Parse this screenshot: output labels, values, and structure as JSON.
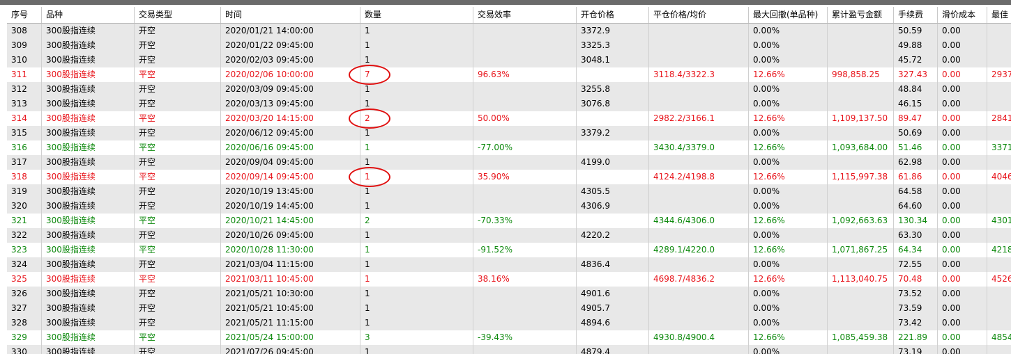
{
  "columns": [
    "序号",
    "品种",
    "交易类型",
    "时间",
    "数量",
    "交易效率",
    "开仓价格",
    "平仓价格/均价",
    "最大回撤(单品种)",
    "累计盈亏金额",
    "手续费",
    "滑价成本",
    "最佳"
  ],
  "rows": [
    {
      "id": "308",
      "product": "300股指连续",
      "type": "开空",
      "time": "2020/01/21 14:00:00",
      "qty": "1",
      "eff": "",
      "open": "3372.9",
      "close": "",
      "dd": "0.00%",
      "pnl": "",
      "fee": "50.59",
      "slip": "0.00",
      "best": "",
      "color": "black",
      "kind": "open"
    },
    {
      "id": "309",
      "product": "300股指连续",
      "type": "开空",
      "time": "2020/01/22 09:45:00",
      "qty": "1",
      "eff": "",
      "open": "3325.3",
      "close": "",
      "dd": "0.00%",
      "pnl": "",
      "fee": "49.88",
      "slip": "0.00",
      "best": "",
      "color": "black",
      "kind": "open"
    },
    {
      "id": "310",
      "product": "300股指连续",
      "type": "开空",
      "time": "2020/02/03 09:45:00",
      "qty": "1",
      "eff": "",
      "open": "3048.1",
      "close": "",
      "dd": "0.00%",
      "pnl": "",
      "fee": "45.72",
      "slip": "0.00",
      "best": "",
      "color": "black",
      "kind": "open"
    },
    {
      "id": "311",
      "product": "300股指连续",
      "type": "平空",
      "time": "2020/02/06 10:00:00",
      "qty": "7",
      "eff": "96.63%",
      "open": "",
      "close": "3118.4/3322.3",
      "dd": "12.66%",
      "pnl": "998,858.25",
      "fee": "327.43",
      "slip": "0.00",
      "best": "2937",
      "color": "red",
      "kind": "closed"
    },
    {
      "id": "312",
      "product": "300股指连续",
      "type": "开空",
      "time": "2020/03/09 09:45:00",
      "qty": "1",
      "eff": "",
      "open": "3255.8",
      "close": "",
      "dd": "0.00%",
      "pnl": "",
      "fee": "48.84",
      "slip": "0.00",
      "best": "",
      "color": "black",
      "kind": "open"
    },
    {
      "id": "313",
      "product": "300股指连续",
      "type": "开空",
      "time": "2020/03/13 09:45:00",
      "qty": "1",
      "eff": "",
      "open": "3076.8",
      "close": "",
      "dd": "0.00%",
      "pnl": "",
      "fee": "46.15",
      "slip": "0.00",
      "best": "",
      "color": "black",
      "kind": "open"
    },
    {
      "id": "314",
      "product": "300股指连续",
      "type": "平空",
      "time": "2020/03/20 14:15:00",
      "qty": "2",
      "eff": "50.00%",
      "open": "",
      "close": "2982.2/3166.1",
      "dd": "12.66%",
      "pnl": "1,109,137.50",
      "fee": "89.47",
      "slip": "0.00",
      "best": "2841",
      "color": "red",
      "kind": "closed"
    },
    {
      "id": "315",
      "product": "300股指连续",
      "type": "开空",
      "time": "2020/06/12 09:45:00",
      "qty": "1",
      "eff": "",
      "open": "3379.2",
      "close": "",
      "dd": "0.00%",
      "pnl": "",
      "fee": "50.69",
      "slip": "0.00",
      "best": "",
      "color": "black",
      "kind": "open"
    },
    {
      "id": "316",
      "product": "300股指连续",
      "type": "平空",
      "time": "2020/06/16 09:45:00",
      "qty": "1",
      "eff": "-77.00%",
      "open": "",
      "close": "3430.4/3379.0",
      "dd": "12.66%",
      "pnl": "1,093,684.00",
      "fee": "51.46",
      "slip": "0.00",
      "best": "3371",
      "color": "green",
      "kind": "closed"
    },
    {
      "id": "317",
      "product": "300股指连续",
      "type": "开空",
      "time": "2020/09/04 09:45:00",
      "qty": "1",
      "eff": "",
      "open": "4199.0",
      "close": "",
      "dd": "0.00%",
      "pnl": "",
      "fee": "62.98",
      "slip": "0.00",
      "best": "",
      "color": "black",
      "kind": "open"
    },
    {
      "id": "318",
      "product": "300股指连续",
      "type": "平空",
      "time": "2020/09/14 09:45:00",
      "qty": "1",
      "eff": "35.90%",
      "open": "",
      "close": "4124.2/4198.8",
      "dd": "12.66%",
      "pnl": "1,115,997.38",
      "fee": "61.86",
      "slip": "0.00",
      "best": "4046",
      "color": "red",
      "kind": "closed"
    },
    {
      "id": "319",
      "product": "300股指连续",
      "type": "开空",
      "time": "2020/10/19 13:45:00",
      "qty": "1",
      "eff": "",
      "open": "4305.5",
      "close": "",
      "dd": "0.00%",
      "pnl": "",
      "fee": "64.58",
      "slip": "0.00",
      "best": "",
      "color": "black",
      "kind": "open"
    },
    {
      "id": "320",
      "product": "300股指连续",
      "type": "开空",
      "time": "2020/10/19 14:45:00",
      "qty": "1",
      "eff": "",
      "open": "4306.9",
      "close": "",
      "dd": "0.00%",
      "pnl": "",
      "fee": "64.60",
      "slip": "0.00",
      "best": "",
      "color": "black",
      "kind": "open"
    },
    {
      "id": "321",
      "product": "300股指连续",
      "type": "平空",
      "time": "2020/10/21 14:45:00",
      "qty": "2",
      "eff": "-70.33%",
      "open": "",
      "close": "4344.6/4306.0",
      "dd": "12.66%",
      "pnl": "1,092,663.63",
      "fee": "130.34",
      "slip": "0.00",
      "best": "4301",
      "color": "green",
      "kind": "closed"
    },
    {
      "id": "322",
      "product": "300股指连续",
      "type": "开空",
      "time": "2020/10/26 09:45:00",
      "qty": "1",
      "eff": "",
      "open": "4220.2",
      "close": "",
      "dd": "0.00%",
      "pnl": "",
      "fee": "63.30",
      "slip": "0.00",
      "best": "",
      "color": "black",
      "kind": "open"
    },
    {
      "id": "323",
      "product": "300股指连续",
      "type": "平空",
      "time": "2020/10/28 11:30:00",
      "qty": "1",
      "eff": "-91.52%",
      "open": "",
      "close": "4289.1/4220.0",
      "dd": "12.66%",
      "pnl": "1,071,867.25",
      "fee": "64.34",
      "slip": "0.00",
      "best": "4218",
      "color": "green",
      "kind": "closed"
    },
    {
      "id": "324",
      "product": "300股指连续",
      "type": "开空",
      "time": "2021/03/04 11:15:00",
      "qty": "1",
      "eff": "",
      "open": "4836.4",
      "close": "",
      "dd": "0.00%",
      "pnl": "",
      "fee": "72.55",
      "slip": "0.00",
      "best": "",
      "color": "black",
      "kind": "open"
    },
    {
      "id": "325",
      "product": "300股指连续",
      "type": "平空",
      "time": "2021/03/11 10:45:00",
      "qty": "1",
      "eff": "38.16%",
      "open": "",
      "close": "4698.7/4836.2",
      "dd": "12.66%",
      "pnl": "1,113,040.75",
      "fee": "70.48",
      "slip": "0.00",
      "best": "4526",
      "color": "red",
      "kind": "closed"
    },
    {
      "id": "326",
      "product": "300股指连续",
      "type": "开空",
      "time": "2021/05/21 10:30:00",
      "qty": "1",
      "eff": "",
      "open": "4901.6",
      "close": "",
      "dd": "0.00%",
      "pnl": "",
      "fee": "73.52",
      "slip": "0.00",
      "best": "",
      "color": "black",
      "kind": "open"
    },
    {
      "id": "327",
      "product": "300股指连续",
      "type": "开空",
      "time": "2021/05/21 10:45:00",
      "qty": "1",
      "eff": "",
      "open": "4905.7",
      "close": "",
      "dd": "0.00%",
      "pnl": "",
      "fee": "73.59",
      "slip": "0.00",
      "best": "",
      "color": "black",
      "kind": "open"
    },
    {
      "id": "328",
      "product": "300股指连续",
      "type": "开空",
      "time": "2021/05/21 11:15:00",
      "qty": "1",
      "eff": "",
      "open": "4894.6",
      "close": "",
      "dd": "0.00%",
      "pnl": "",
      "fee": "73.42",
      "slip": "0.00",
      "best": "",
      "color": "black",
      "kind": "open"
    },
    {
      "id": "329",
      "product": "300股指连续",
      "type": "平空",
      "time": "2021/05/24 15:00:00",
      "qty": "3",
      "eff": "-39.43%",
      "open": "",
      "close": "4930.8/4900.4",
      "dd": "12.66%",
      "pnl": "1,085,459.38",
      "fee": "221.89",
      "slip": "0.00",
      "best": "4854",
      "color": "green",
      "kind": "closed"
    },
    {
      "id": "330",
      "product": "300股指连续",
      "type": "开空",
      "time": "2021/07/26 09:45:00",
      "qty": "1",
      "eff": "",
      "open": "4879.4",
      "close": "",
      "dd": "0.00%",
      "pnl": "",
      "fee": "73.19",
      "slip": "0.00",
      "best": "",
      "color": "black",
      "kind": "open"
    }
  ],
  "annotations": [
    {
      "row": "311",
      "color": "#e01010"
    },
    {
      "row": "314",
      "color": "#e01010"
    },
    {
      "row": "318",
      "color": "#e01010"
    }
  ]
}
